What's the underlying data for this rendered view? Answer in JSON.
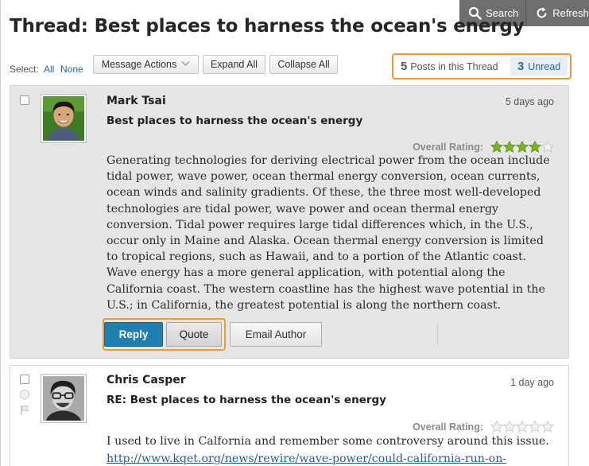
{
  "toolbar": {
    "search_label": "Search",
    "refresh_label": "Refresh"
  },
  "thread": {
    "title": "Thread: Best places to harness the ocean's energy"
  },
  "actions": {
    "select_label": "Select:",
    "all_label": "All",
    "none_label": "None",
    "message_actions_label": "Message Actions",
    "expand_all_label": "Expand All",
    "collapse_all_label": "Collapse All"
  },
  "counts": {
    "posts_count": "5",
    "posts_label": "Posts in this Thread",
    "unread_count": "3",
    "unread_label": "Unread"
  },
  "colors": {
    "highlight": "#f29a2f",
    "reply_button": "#1f7fb0",
    "link": "#1f6aa5",
    "star_filled": "#7ab51d",
    "star_empty": "#d9d9d9"
  },
  "posts": [
    {
      "author": "Mark Tsai",
      "subject": "Best places to harness the ocean's energy",
      "time": "5 days ago",
      "rating_label": "Overall Rating:",
      "rating": 4,
      "rating_max": 5,
      "body": "Generating technologies for deriving electrical power from the ocean include tidal power, wave power, ocean thermal energy conversion, ocean currents, ocean winds and salinity gradients. Of these, the three most well-developed technologies are tidal power, wave power and ocean thermal energy conversion. Tidal power requires large tidal differences which, in the U.S., occur only in Maine and Alaska. Ocean thermal energy conversion is limited to tropical regions, such as Hawaii, and to a portion of the Atlantic coast. Wave energy has a more general application, with potential along the California coast. The western coastline has the highest wave potential in the U.S.; in California, the greatest potential is along the northern coast.",
      "reply_label": "Reply",
      "quote_label": "Quote",
      "email_label": "Email Author"
    },
    {
      "author": "Chris Casper",
      "subject": "RE: Best places to harness the ocean's energy",
      "time": "1 day ago",
      "rating_label": "Overall Rating:",
      "rating": 0,
      "rating_max": 5,
      "body": "I used to live in Calfornia and remember some controversy around this issue.",
      "link": "http://www.kqet.org/news/rewire/wave-power/could-california-run-on-"
    }
  ]
}
